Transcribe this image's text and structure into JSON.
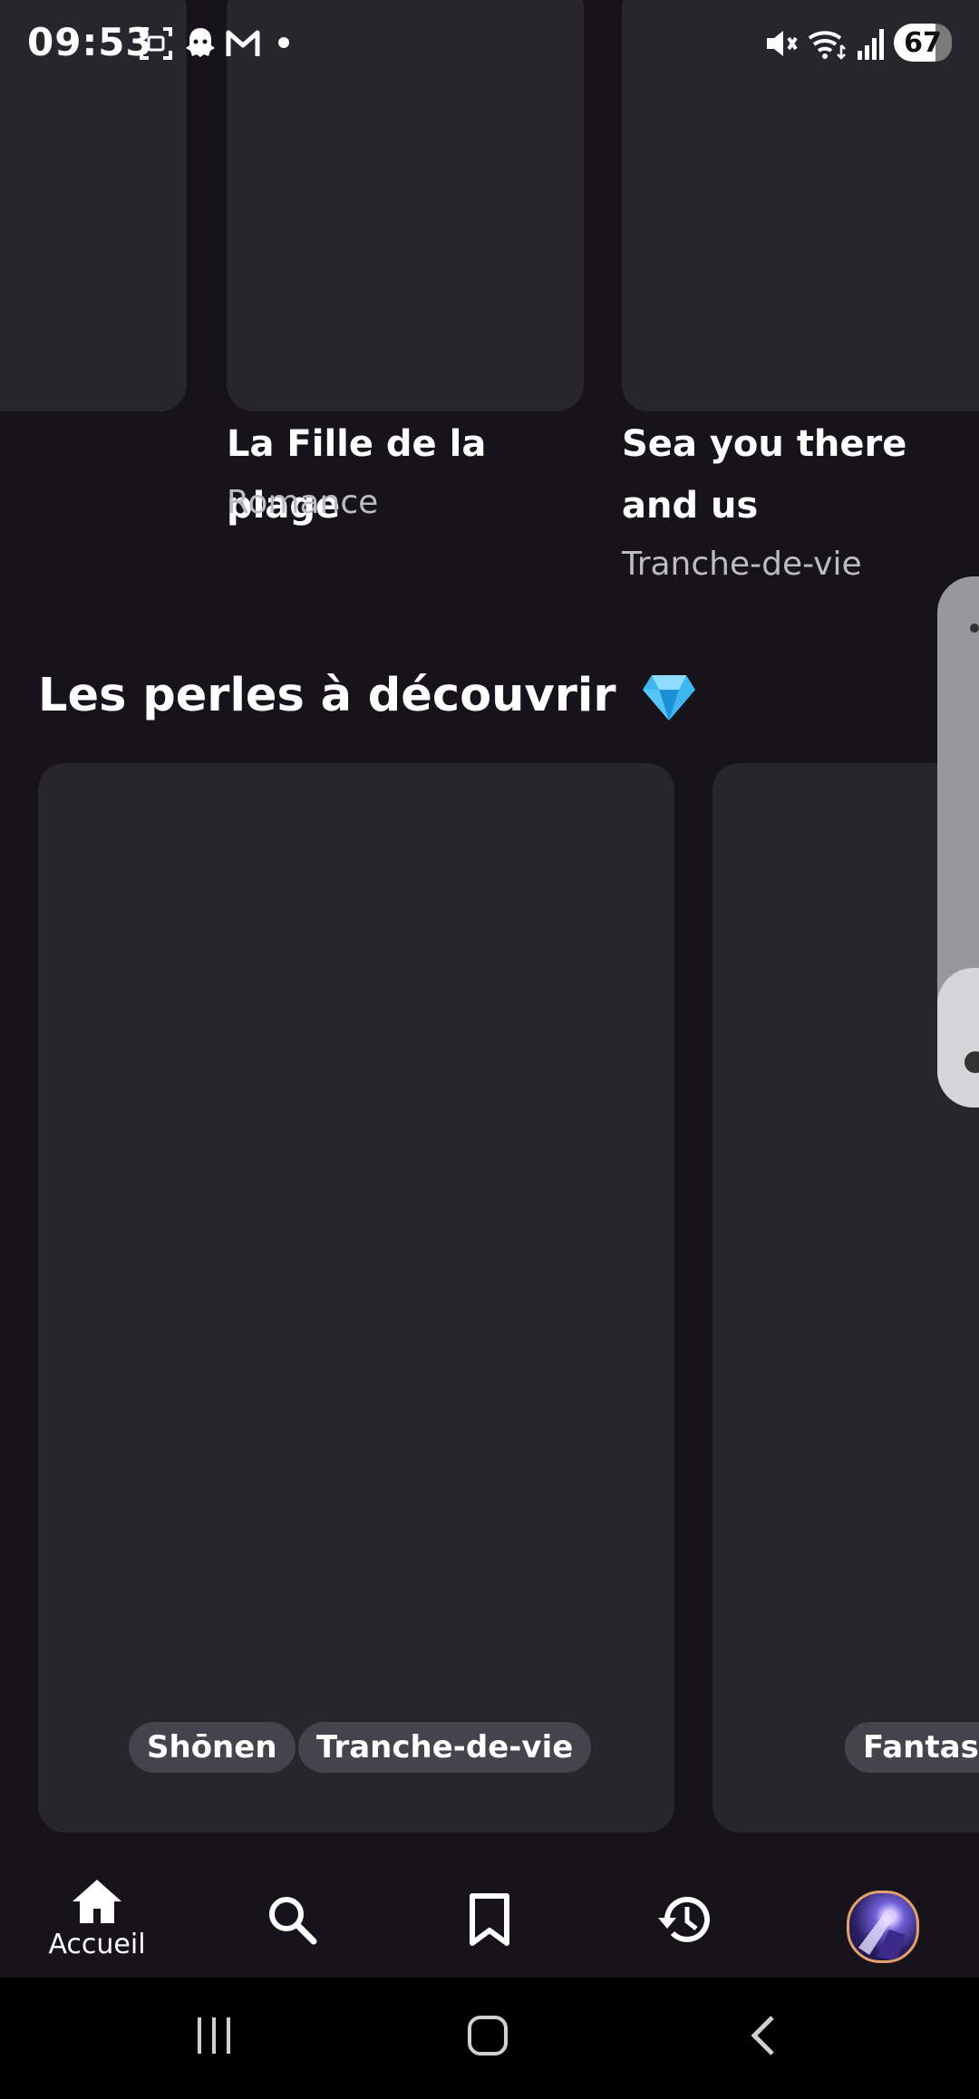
{
  "status_bar": {
    "time": "09:53",
    "battery": "67",
    "left_icons": [
      "screenshot-icon",
      "snapchat-icon",
      "gmail-icon",
      "dot-icon"
    ],
    "right_icons": [
      "mute-icon",
      "wifi-icon",
      "signal-icon",
      "battery-icon"
    ]
  },
  "top_row": {
    "cards": [
      {
        "title": "",
        "genre": ""
      },
      {
        "title": "La Fille de la plage",
        "genre": "Romance"
      },
      {
        "title": "Sea you there and us",
        "genre": "Tranche-de-vie"
      }
    ]
  },
  "section": {
    "title": "Les perles à découvrir",
    "emoji": "gem-icon"
  },
  "gems_row": {
    "cards": [
      {
        "tags": [
          "Shōnen",
          "Tranche-de-vie"
        ]
      },
      {
        "tags": [
          "Fantast"
        ]
      }
    ]
  },
  "bottom_nav": {
    "items": [
      {
        "icon": "home-icon",
        "label": "Accueil"
      },
      {
        "icon": "search-icon",
        "label": ""
      },
      {
        "icon": "bookmark-icon",
        "label": ""
      },
      {
        "icon": "history-icon",
        "label": ""
      },
      {
        "icon": "avatar",
        "label": ""
      }
    ]
  },
  "colors": {
    "background": "#16131a",
    "card": "#27262c",
    "tag": "#45434b",
    "muted_text": "#bcbcc2"
  }
}
